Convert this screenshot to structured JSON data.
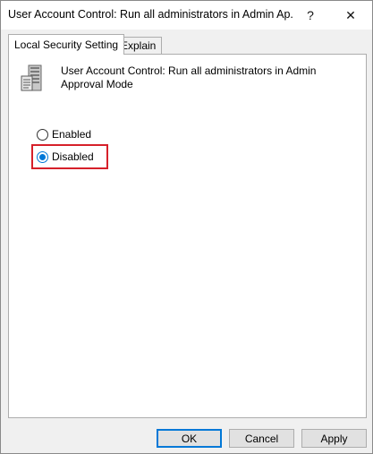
{
  "window": {
    "title": "User Account Control: Run all administrators in Admin Ap...",
    "help_label": "?",
    "close_label": "✕"
  },
  "tabs": [
    {
      "label": "Local Security Setting",
      "active": true
    },
    {
      "label": "Explain",
      "active": false
    }
  ],
  "policy": {
    "icon": "server-policy-icon",
    "title": "User Account Control: Run all administrators in Admin Approval Mode"
  },
  "options": {
    "enabled_label": "Enabled",
    "disabled_label": "Disabled",
    "selected": "Disabled"
  },
  "buttons": {
    "ok_label": "OK",
    "cancel_label": "Cancel",
    "apply_label": "Apply"
  },
  "colors": {
    "accent": "#0078d7",
    "highlight": "#d6202a"
  }
}
